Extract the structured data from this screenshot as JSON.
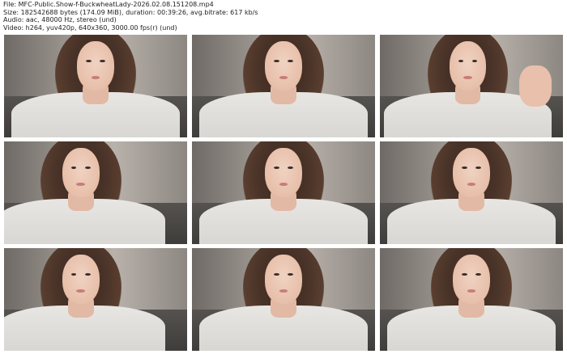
{
  "header": {
    "file_line": "File: MFC-Public.Show-f-BuckwheatLady-2026.02.08.151208.mp4",
    "size_line": "Size: 182542688 bytes (174.09 MiB), duration: 00:39:26, avg.bitrate: 617 kb/s",
    "audio_line": "Audio: aac, 48000 Hz, stereo (und)",
    "video_line": "Video: h264, yuv420p, 640x360, 3000.00 fps(r) (und)"
  },
  "thumbnails": [
    {
      "pose": "center"
    },
    {
      "pose": "center"
    },
    {
      "pose": "hand"
    },
    {
      "pose": "left"
    },
    {
      "pose": "center"
    },
    {
      "pose": "center"
    },
    {
      "pose": "left"
    },
    {
      "pose": "center"
    },
    {
      "pose": "center"
    }
  ]
}
